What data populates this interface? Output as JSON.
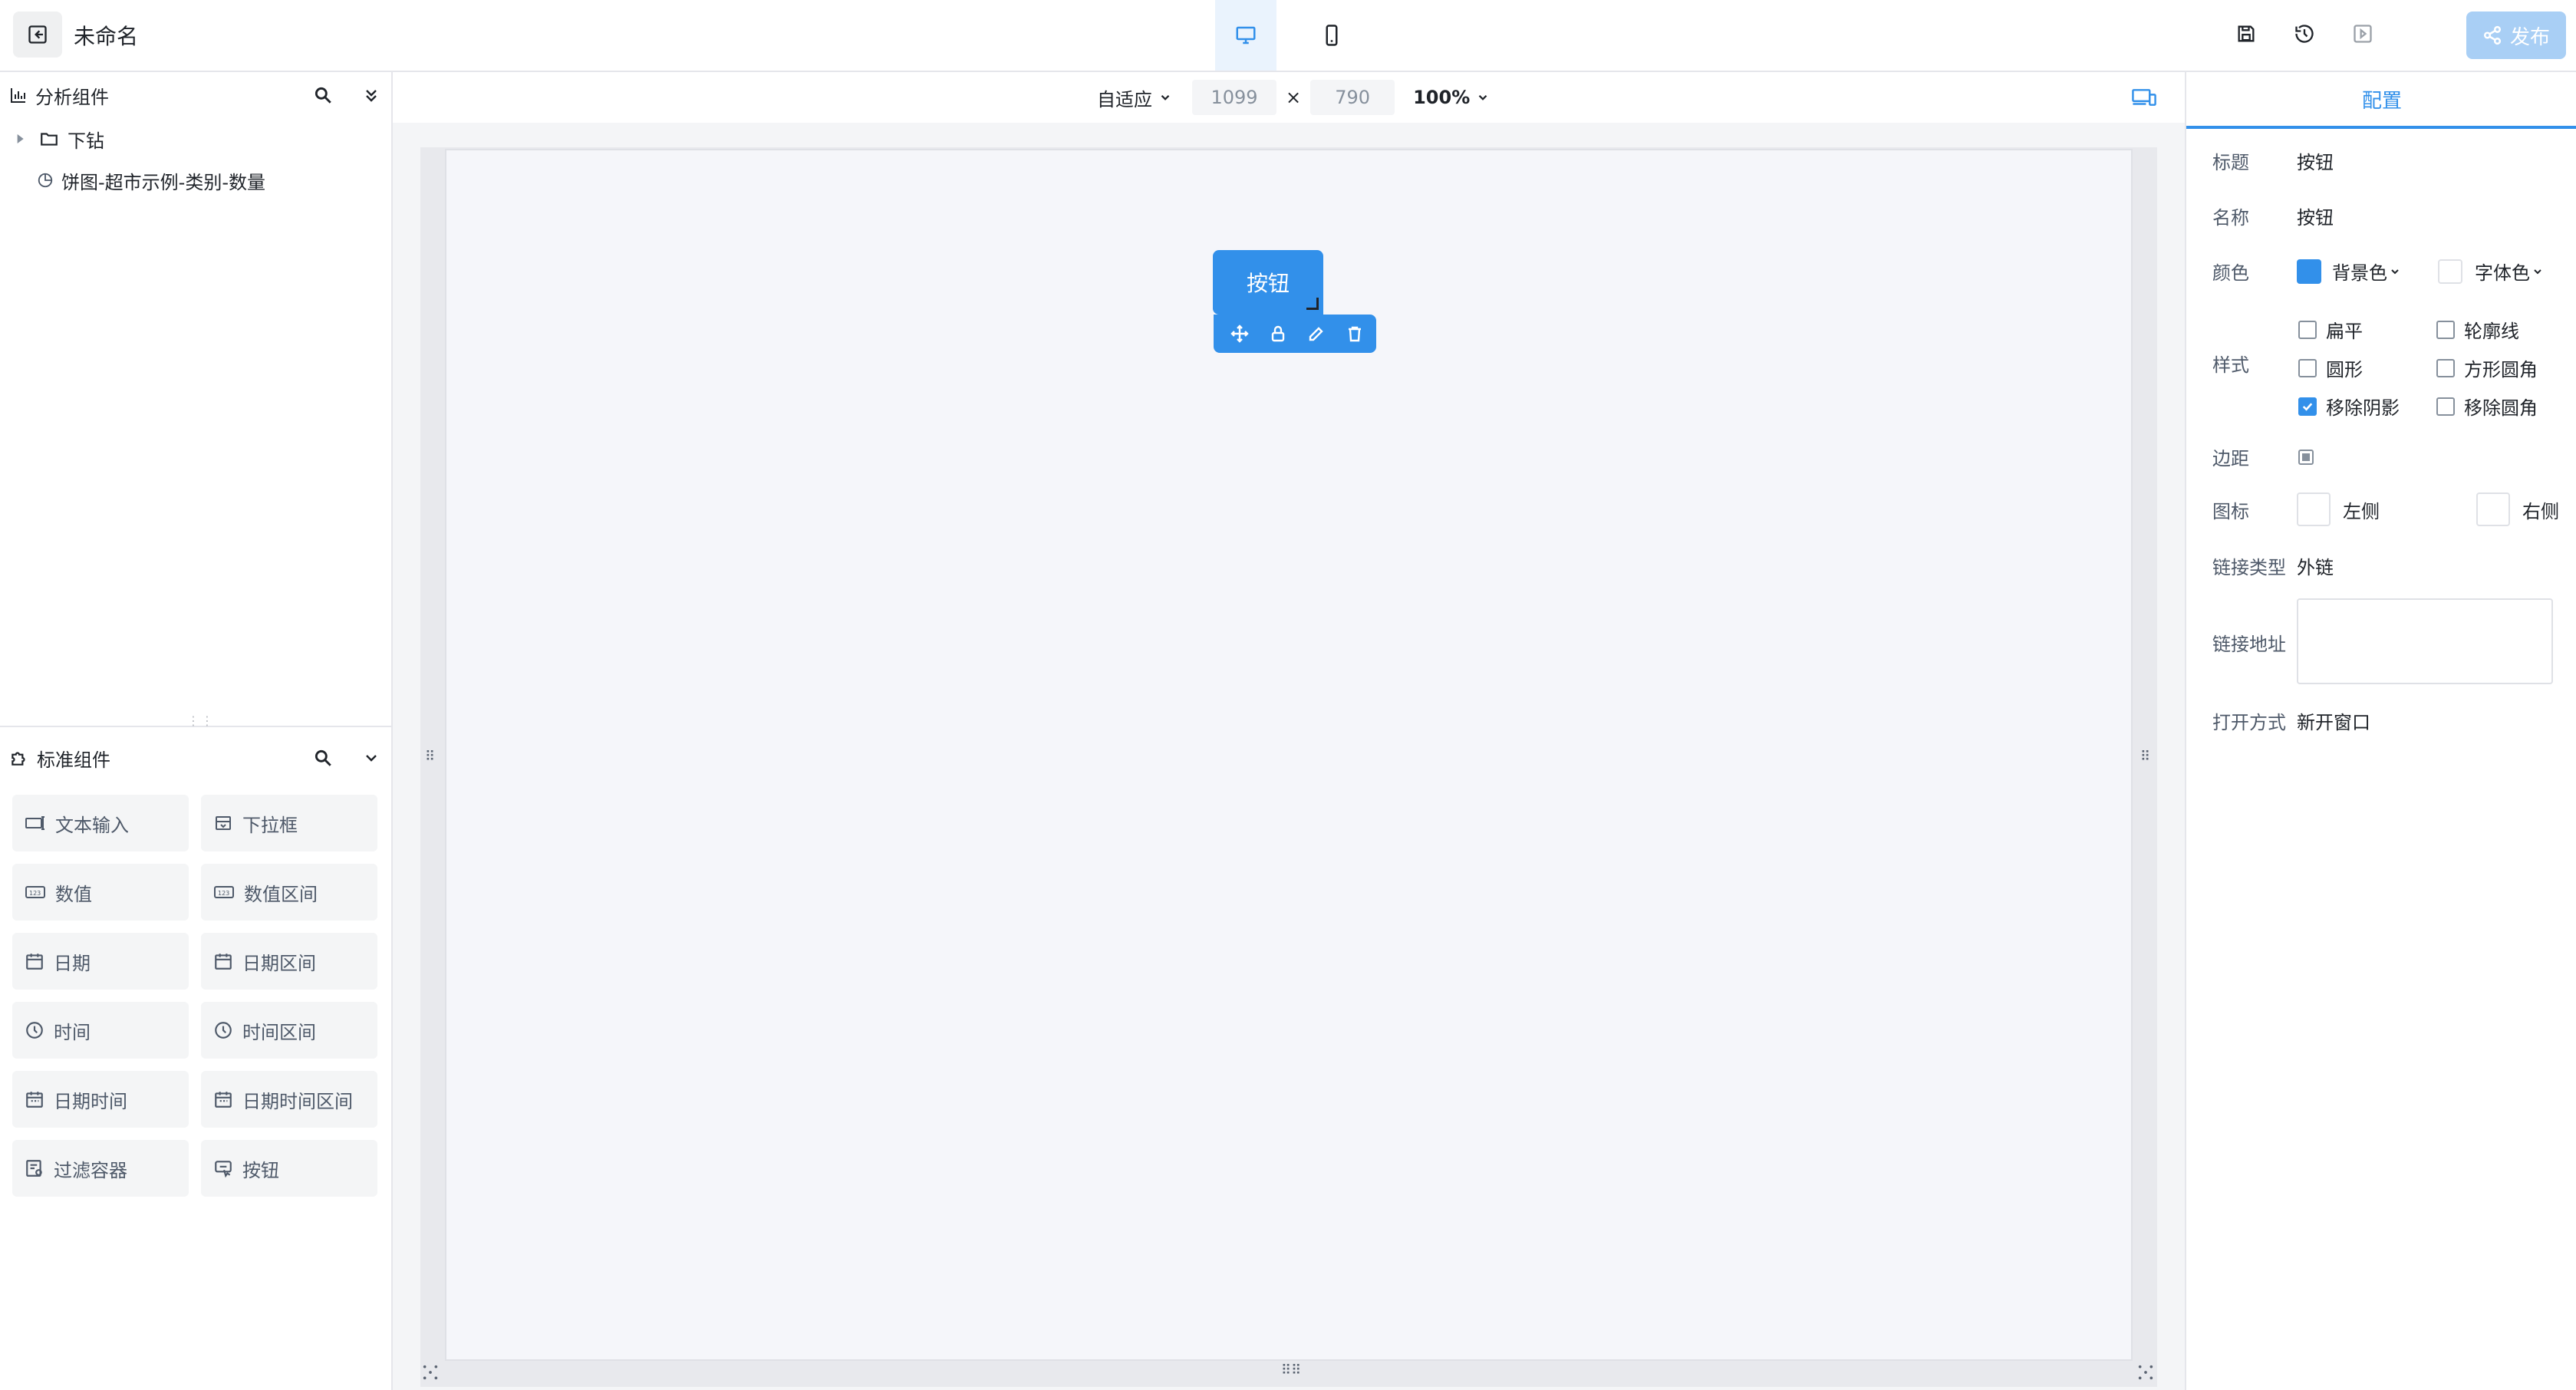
{
  "header": {
    "doc_title": "未命名",
    "publish_label": "发布"
  },
  "analysis_panel": {
    "title": "分析组件",
    "tree": [
      {
        "label": "下钻",
        "type": "folder"
      },
      {
        "label": "饼图-超市示例-类别-数量",
        "type": "chart"
      }
    ]
  },
  "standard_panel": {
    "title": "标准组件",
    "components": [
      {
        "label": "文本输入",
        "icon": "text-input-icon"
      },
      {
        "label": "下拉框",
        "icon": "dropdown-icon"
      },
      {
        "label": "数值",
        "icon": "number-icon"
      },
      {
        "label": "数值区间",
        "icon": "number-range-icon"
      },
      {
        "label": "日期",
        "icon": "calendar-icon"
      },
      {
        "label": "日期区间",
        "icon": "calendar-range-icon"
      },
      {
        "label": "时间",
        "icon": "clock-icon"
      },
      {
        "label": "时间区间",
        "icon": "clock-range-icon"
      },
      {
        "label": "日期时间",
        "icon": "datetime-icon"
      },
      {
        "label": "日期时间区间",
        "icon": "datetime-range-icon"
      },
      {
        "label": "过滤容器",
        "icon": "filter-container-icon"
      },
      {
        "label": "按钮",
        "icon": "button-icon"
      }
    ]
  },
  "canvas_toolbar": {
    "fit_mode": "自适应",
    "width": "1099",
    "height": "790",
    "times": "×",
    "zoom": "100%"
  },
  "canvas": {
    "button_label": "按钮"
  },
  "config_panel": {
    "tab": "配置",
    "title_label": "标题",
    "title_value": "按钮",
    "name_label": "名称",
    "name_value": "按钮",
    "color_label": "颜色",
    "bg_color_label": "背景色",
    "font_color_label": "字体色",
    "style_label": "样式",
    "styles": [
      {
        "label": "扁平",
        "checked": false
      },
      {
        "label": "轮廓线",
        "checked": false
      },
      {
        "label": "圆形",
        "checked": false
      },
      {
        "label": "方形圆角",
        "checked": false
      },
      {
        "label": "移除阴影",
        "checked": true
      },
      {
        "label": "移除圆角",
        "checked": false
      }
    ],
    "margin_label": "边距",
    "icon_label": "图标",
    "icon_left": "左侧",
    "icon_right": "右侧",
    "link_type_label": "链接类型",
    "link_type_value": "外链",
    "link_url_label": "链接地址",
    "link_url_value": "",
    "open_mode_label": "打开方式",
    "open_mode_value": "新开窗口"
  },
  "colors": {
    "accent": "#3290ea",
    "bg_swatch": "#3290ea",
    "font_swatch": "#ffffff",
    "publish_disabled": "#a9cff5"
  }
}
